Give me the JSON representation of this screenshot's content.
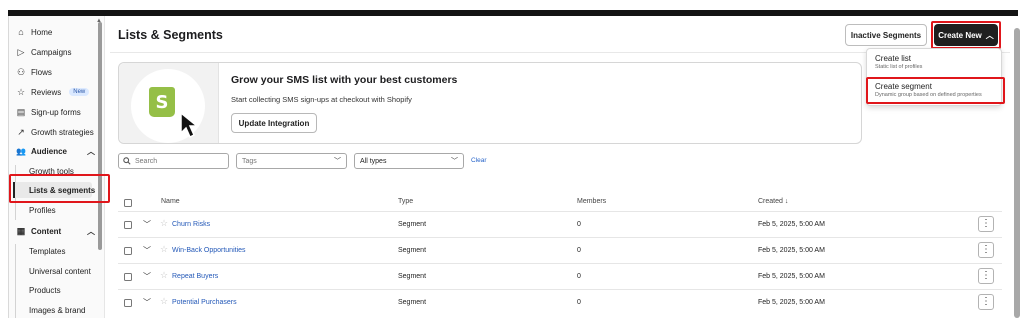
{
  "sidebar": {
    "items": [
      {
        "label": "Home",
        "icon": "home-icon",
        "glyph": "⌂"
      },
      {
        "label": "Campaigns",
        "icon": "send-icon",
        "glyph": "▷"
      },
      {
        "label": "Flows",
        "icon": "flows-icon",
        "glyph": "⚇"
      },
      {
        "label": "Reviews",
        "icon": "star-icon",
        "glyph": "☆",
        "badge": "New"
      },
      {
        "label": "Sign-up forms",
        "icon": "form-icon",
        "glyph": "▤"
      },
      {
        "label": "Growth strategies",
        "icon": "trend-icon",
        "glyph": "↗"
      },
      {
        "label": "Audience",
        "icon": "people-icon",
        "glyph": "👥",
        "expanded": true
      },
      {
        "label": "Content",
        "icon": "content-icon",
        "glyph": "▦",
        "expanded": true
      }
    ],
    "audience_sub": [
      "Growth tools",
      "Lists & segments",
      "Profiles"
    ],
    "content_sub": [
      "Templates",
      "Universal content",
      "Products",
      "Images & brand"
    ]
  },
  "header": {
    "title": "Lists & Segments",
    "inactive_label": "Inactive Segments",
    "create_label": "Create New"
  },
  "dropdown": {
    "items": [
      {
        "label": "Create list",
        "desc": "Static list of profiles"
      },
      {
        "label": "Create segment",
        "desc": "Dynamic group based on defined properties"
      }
    ]
  },
  "banner": {
    "title": "Grow your SMS list with your best customers",
    "subtitle": "Start collecting SMS sign-ups at checkout with Shopify",
    "button": "Update Integration",
    "logo_letter": "S",
    "logo_color": "#95bf47"
  },
  "filters": {
    "search_placeholder": "Search",
    "tags_placeholder": "Tags",
    "types_value": "All types",
    "clear_label": "Clear"
  },
  "table": {
    "columns": {
      "name": "Name",
      "type": "Type",
      "members": "Members",
      "created": "Created ↓"
    },
    "rows": [
      {
        "name": "Churn Risks",
        "type": "Segment",
        "members": "0",
        "created": "Feb 5, 2025, 5:00 AM"
      },
      {
        "name": "Win-Back Opportunities",
        "type": "Segment",
        "members": "0",
        "created": "Feb 5, 2025, 5:00 AM"
      },
      {
        "name": "Repeat Buyers",
        "type": "Segment",
        "members": "0",
        "created": "Feb 5, 2025, 5:00 AM"
      },
      {
        "name": "Potential Purchasers",
        "type": "Segment",
        "members": "0",
        "created": "Feb 5, 2025, 5:00 AM"
      }
    ]
  },
  "colors": {
    "highlight": "#e0161b",
    "link": "#2459b8",
    "dark_button": "#1f1f1f"
  }
}
